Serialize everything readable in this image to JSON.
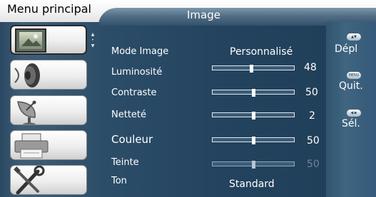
{
  "header": {
    "menu_title": "Menu principal",
    "section_title": "Image"
  },
  "sidebar": {
    "items": [
      {
        "name": "picture",
        "icon": "picture-icon",
        "selected": true
      },
      {
        "name": "sound",
        "icon": "speaker-icon",
        "selected": false
      },
      {
        "name": "channel",
        "icon": "satellite-dish-icon",
        "selected": false
      },
      {
        "name": "features",
        "icon": "printer-icon",
        "selected": false
      },
      {
        "name": "setup",
        "icon": "tools-icon",
        "selected": false
      }
    ],
    "scroll_up": "▲",
    "scroll_down": "▼"
  },
  "settings": [
    {
      "label": "Mode Image",
      "type": "option",
      "value": "Personnalisé"
    },
    {
      "label": "Luminosité",
      "type": "slider",
      "value": "48",
      "level": 0.48
    },
    {
      "label": "Contraste",
      "type": "slider",
      "value": "50",
      "level": 0.5
    },
    {
      "label": "Netteté",
      "type": "slider",
      "value": "2",
      "level": 0.5
    },
    {
      "label": "Couleur",
      "type": "slider",
      "value": "50",
      "level": 0.5
    },
    {
      "label": "Teinte",
      "type": "slider",
      "value": "50",
      "level": 0.5,
      "disabled": true
    },
    {
      "label": "Ton",
      "type": "option",
      "value": "Standard"
    }
  ],
  "hints": [
    {
      "icon": "up-down-icon",
      "icon_text": "▲▼",
      "label": "Dépl"
    },
    {
      "icon": "menu-icon",
      "icon_text": "MENU",
      "label": "Quit."
    },
    {
      "icon": "left-right-icon",
      "icon_text": "◀ ▶",
      "label": "Sél."
    }
  ],
  "colors": {
    "panel": "#23435e",
    "tab": "#526f86",
    "text": "#ffffff",
    "disabled": "#6e8599"
  }
}
